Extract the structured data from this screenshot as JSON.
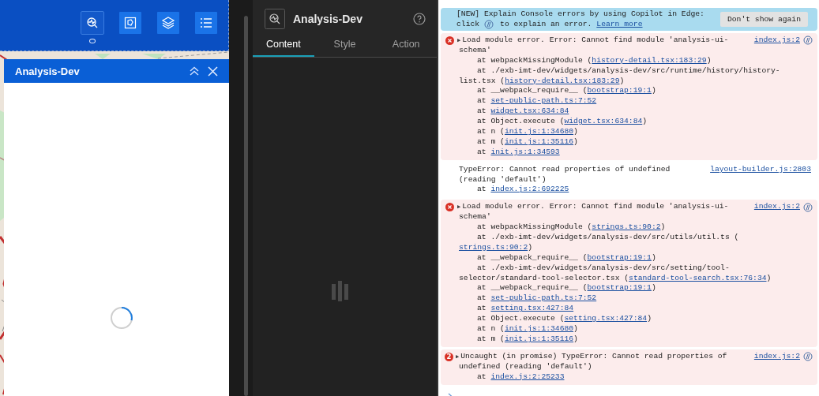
{
  "app_preview": {
    "toolbar": [
      {
        "selected": true
      },
      {
        "selected": false
      },
      {
        "selected": false
      },
      {
        "selected": false
      }
    ],
    "panel": {
      "title": "Analysis-Dev"
    }
  },
  "settings": {
    "title": "Analysis-Dev",
    "tabs": [
      {
        "label": "Content",
        "selected": true
      },
      {
        "label": "Style",
        "selected": false
      },
      {
        "label": "Action",
        "selected": false
      }
    ]
  },
  "console": {
    "banner": {
      "line_1": "[NEW] Explain Console errors by using Copilot in Edge:",
      "line_2_start": "click",
      "line_2_end": "to explain an error.",
      "link": "Learn more",
      "button": "Don't show again"
    },
    "messages": [
      {
        "kind": "error",
        "expander": "▶",
        "source": "index.js:2",
        "copilot": true,
        "lines": [
          {
            "kind": "head",
            "parts": [
              {
                "t": "Load module error. Error: Cannot find module 'analysis-ui-"
              }
            ]
          },
          {
            "kind": "wrap",
            "parts": [
              {
                "t": "schema'"
              }
            ]
          },
          {
            "kind": "stack",
            "parts": [
              {
                "t": "at webpackMissingModule ("
              },
              {
                "t": "history-detail.tsx:183:29",
                "link": true
              },
              {
                "t": ")"
              }
            ]
          },
          {
            "kind": "stack",
            "parts": [
              {
                "t": "at ./exb-imt-dev/widgets/analysis-dev/src/runtime/history/history-"
              }
            ]
          },
          {
            "kind": "wrap",
            "parts": [
              {
                "t": "list.tsx ("
              },
              {
                "t": "history-detail.tsx:183:29",
                "link": true
              },
              {
                "t": ")"
              }
            ]
          },
          {
            "kind": "stack",
            "parts": [
              {
                "t": "at __webpack_require__ ("
              },
              {
                "t": "bootstrap:19:1",
                "link": true
              },
              {
                "t": ")"
              }
            ]
          },
          {
            "kind": "stack",
            "parts": [
              {
                "t": "at "
              },
              {
                "t": "set-public-path.ts:7:52",
                "link": true
              }
            ]
          },
          {
            "kind": "stack",
            "parts": [
              {
                "t": "at "
              },
              {
                "t": "widget.tsx:634:84",
                "link": true
              }
            ]
          },
          {
            "kind": "stack",
            "parts": [
              {
                "t": "at Object.execute ("
              },
              {
                "t": "widget.tsx:634:84",
                "link": true
              },
              {
                "t": ")"
              }
            ]
          },
          {
            "kind": "stack",
            "parts": [
              {
                "t": "at n ("
              },
              {
                "t": "init.js:1:34680",
                "link": true
              },
              {
                "t": ")"
              }
            ]
          },
          {
            "kind": "stack",
            "parts": [
              {
                "t": "at m ("
              },
              {
                "t": "init.js:1:35116",
                "link": true
              },
              {
                "t": ")"
              }
            ]
          },
          {
            "kind": "stack",
            "parts": [
              {
                "t": "at "
              },
              {
                "t": "init.js:1:34593",
                "link": true
              }
            ]
          }
        ]
      },
      {
        "kind": "log",
        "source": "layout-builder.js:2803",
        "copilot": false,
        "lines": [
          {
            "kind": "head",
            "parts": [
              {
                "t": "TypeError: Cannot read properties of undefined"
              }
            ]
          },
          {
            "kind": "wrap",
            "parts": [
              {
                "t": "(reading 'default')"
              }
            ]
          },
          {
            "kind": "stack",
            "parts": [
              {
                "t": "at "
              },
              {
                "t": "index.js:2:692225",
                "link": true
              }
            ]
          }
        ]
      },
      {
        "kind": "error",
        "expander": "▶",
        "source": "index.js:2",
        "copilot": true,
        "lines": [
          {
            "kind": "head",
            "parts": [
              {
                "t": "Load module error. Error: Cannot find module 'analysis-ui-"
              }
            ]
          },
          {
            "kind": "wrap",
            "parts": [
              {
                "t": "schema'"
              }
            ]
          },
          {
            "kind": "stack",
            "parts": [
              {
                "t": "at webpackMissingModule ("
              },
              {
                "t": "strings.ts:90:2",
                "link": true
              },
              {
                "t": ")"
              }
            ]
          },
          {
            "kind": "stack",
            "parts": [
              {
                "t": "at ./exb-imt-dev/widgets/analysis-dev/src/utils/util.ts ("
              }
            ]
          },
          {
            "kind": "wrap",
            "parts": [
              {
                "t": "strings.ts:90:2",
                "link": true
              },
              {
                "t": ")"
              }
            ]
          },
          {
            "kind": "stack",
            "parts": [
              {
                "t": "at __webpack_require__ ("
              },
              {
                "t": "bootstrap:19:1",
                "link": true
              },
              {
                "t": ")"
              }
            ]
          },
          {
            "kind": "stack",
            "parts": [
              {
                "t": "at ./exb-imt-dev/widgets/analysis-dev/src/setting/tool-"
              }
            ]
          },
          {
            "kind": "wrap",
            "parts": [
              {
                "t": "selector/standard-tool-selector.tsx ("
              },
              {
                "t": "standard-tool-search.tsx:76:34",
                "link": true
              },
              {
                "t": ")"
              }
            ]
          },
          {
            "kind": "stack",
            "parts": [
              {
                "t": "at __webpack_require__ ("
              },
              {
                "t": "bootstrap:19:1",
                "link": true
              },
              {
                "t": ")"
              }
            ]
          },
          {
            "kind": "stack",
            "parts": [
              {
                "t": "at "
              },
              {
                "t": "set-public-path.ts:7:52",
                "link": true
              }
            ]
          },
          {
            "kind": "stack",
            "parts": [
              {
                "t": "at "
              },
              {
                "t": "setting.tsx:427:84",
                "link": true
              }
            ]
          },
          {
            "kind": "stack",
            "parts": [
              {
                "t": "at Object.execute ("
              },
              {
                "t": "setting.tsx:427:84",
                "link": true
              },
              {
                "t": ")"
              }
            ]
          },
          {
            "kind": "stack",
            "parts": [
              {
                "t": "at n ("
              },
              {
                "t": "init.js:1:34680",
                "link": true
              },
              {
                "t": ")"
              }
            ]
          },
          {
            "kind": "stack",
            "parts": [
              {
                "t": "at m ("
              },
              {
                "t": "init.js:1:35116",
                "link": true
              },
              {
                "t": ")"
              }
            ]
          }
        ]
      },
      {
        "kind": "error",
        "count": "2",
        "expander": "▶",
        "source": "index.js:2",
        "copilot": true,
        "lines": [
          {
            "kind": "head",
            "parts": [
              {
                "t": "Uncaught (in promise) TypeError: Cannot read properties of"
              }
            ]
          },
          {
            "kind": "wrap",
            "parts": [
              {
                "t": "undefined (reading 'default')"
              }
            ]
          },
          {
            "kind": "stack",
            "parts": [
              {
                "t": "at "
              },
              {
                "t": "index.js:2:25233",
                "link": true
              }
            ]
          }
        ]
      }
    ]
  }
}
